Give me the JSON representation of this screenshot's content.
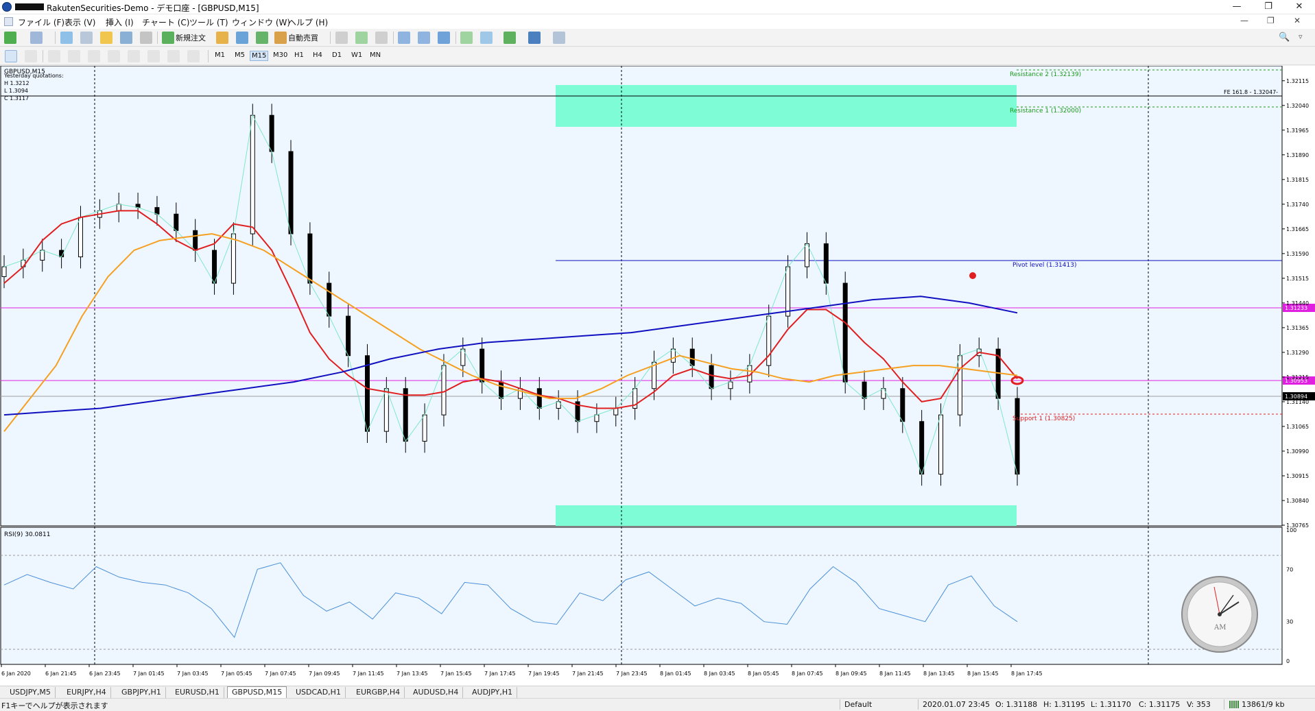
{
  "window": {
    "title": "RakutenSecurities-Demo - デモ口座 - [GBPUSD,M15]"
  },
  "menu": [
    "ファイル (F)",
    "表示 (V)",
    "挿入 (I)",
    "チャート (C)",
    "ツール (T)",
    "ウィンドウ (W)",
    "ヘルプ (H)"
  ],
  "toolbar": {
    "new_order": "新規注文",
    "auto_trading": "自動売買"
  },
  "timeframes": [
    "M1",
    "M5",
    "M15",
    "M30",
    "H1",
    "H4",
    "D1",
    "W1",
    "MN"
  ],
  "timeframe_selected": "M15",
  "chart": {
    "symbol_label": "GBPUSD,M15",
    "quote_title": "Yesterday quotations:",
    "quote_h": "H 1.3212",
    "quote_l": "L 1.3094",
    "quote_c": "C 1.3117",
    "price_ticks": [
      "1.32115",
      "1.32040",
      "1.31965",
      "1.31890",
      "1.31815",
      "1.31740",
      "1.31665",
      "1.31590",
      "1.31515",
      "1.31440",
      "1.31365",
      "1.31290",
      "1.31215",
      "1.31140",
      "1.31065",
      "1.30990",
      "1.30915",
      "1.30840",
      "1.30765"
    ],
    "resistance2_label": "Resistance 2 (1.32139)",
    "resistance1_label": "Resistance 1 (1.32000)",
    "fe_label": "FE 161.8 - 1.32047-",
    "pivot_label": "Pivot level (1.31413)",
    "support1_label": "Support 1 (1.30825)",
    "magenta_upper_price": "1.31233",
    "magenta_lower_price": "1.30953",
    "current_price": "1.30894",
    "rsi_label": "RSI(9) 30.0811",
    "rsi_ticks": [
      "100",
      "70",
      "30",
      "0"
    ],
    "time_labels": [
      "6 Jan 2020",
      "6 Jan 21:45",
      "6 Jan 23:45",
      "7 Jan 01:45",
      "7 Jan 03:45",
      "7 Jan 05:45",
      "7 Jan 07:45",
      "7 Jan 09:45",
      "7 Jan 11:45",
      "7 Jan 13:45",
      "7 Jan 15:45",
      "7 Jan 17:45",
      "7 Jan 19:45",
      "7 Jan 21:45",
      "7 Jan 23:45",
      "8 Jan 01:45",
      "8 Jan 03:45",
      "8 Jan 05:45",
      "8 Jan 07:45",
      "8 Jan 09:45",
      "8 Jan 11:45",
      "8 Jan 13:45",
      "8 Jan 15:45",
      "8 Jan 17:45"
    ],
    "clock_text": "AM",
    "colors": {
      "candle": "#000000",
      "ma_fast": "#7fe8c8",
      "ma_mid": "#e02020",
      "ma_slow": "#f5a020",
      "ma_long": "#1010c0",
      "zone": "#7dfcd6",
      "magenta": "#e020e0",
      "rsi": "#4a90d9",
      "background": "#eef6ff"
    }
  },
  "chart_data": {
    "type": "line",
    "title": "GBPUSD,M15",
    "ylim": [
      1.30765,
      1.32152
    ],
    "levels": {
      "resistance2": 1.32139,
      "resistance1": 1.32,
      "fe_161_8": 1.32047,
      "pivot": 1.31413,
      "support1": 1.30825,
      "magenta_upper": 1.31233,
      "magenta_lower": 1.30953,
      "current": 1.30894
    },
    "series": [
      {
        "values": [
          1.3155,
          1.3157,
          1.316,
          1.3158,
          1.317,
          1.3172,
          1.3174,
          1.3173,
          1.3171,
          1.3166,
          1.316,
          1.315,
          1.3165,
          1.3201,
          1.319,
          1.3165,
          1.315,
          1.314,
          1.3128,
          1.3105,
          1.3118,
          1.3102,
          1.311,
          1.3125,
          1.313,
          1.312,
          1.3115,
          1.3118,
          1.3112,
          1.3114,
          1.3108,
          1.311,
          1.3112,
          1.3118,
          1.3126,
          1.313,
          1.3125,
          1.3118,
          1.312,
          1.3125,
          1.314,
          1.3155,
          1.3162,
          1.315,
          1.312,
          1.3115,
          1.3118,
          1.3108,
          1.3092,
          1.311,
          1.3128,
          1.313,
          1.3115,
          1.3092
        ]
      },
      {
        "values": [
          1.315,
          1.3155,
          1.3163,
          1.3168,
          1.317,
          1.3171,
          1.3172,
          1.3172,
          1.3168,
          1.3163,
          1.316,
          1.3162,
          1.3168,
          1.3167,
          1.316,
          1.3148,
          1.3135,
          1.3127,
          1.3122,
          1.3118,
          1.3117,
          1.3116,
          1.3116,
          1.3117,
          1.312,
          1.3121,
          1.312,
          1.3118,
          1.3116,
          1.3115,
          1.3113,
          1.3112,
          1.3112,
          1.3113,
          1.3117,
          1.3122,
          1.3124,
          1.3122,
          1.3121,
          1.3122,
          1.3128,
          1.3136,
          1.3142,
          1.3142,
          1.3138,
          1.3132,
          1.3127,
          1.312,
          1.3114,
          1.3115,
          1.3124,
          1.3129,
          1.3128,
          1.3121
        ]
      },
      {
        "values": [
          1.3105,
          1.3115,
          1.3125,
          1.314,
          1.3152,
          1.316,
          1.3163,
          1.3164,
          1.3165,
          1.3163,
          1.316,
          1.3155,
          1.315,
          1.3145,
          1.314,
          1.3135,
          1.313,
          1.3126,
          1.3122,
          1.3119,
          1.3117,
          1.3115,
          1.3115,
          1.3118,
          1.3122,
          1.3125,
          1.3128,
          1.3126,
          1.3124,
          1.3123,
          1.3121,
          1.312,
          1.3122,
          1.3123,
          1.3124,
          1.3125,
          1.3125,
          1.3124,
          1.3123,
          1.3122
        ]
      },
      {
        "values": [
          1.311,
          1.3111,
          1.3112,
          1.3114,
          1.3116,
          1.3118,
          1.312,
          1.3123,
          1.3127,
          1.313,
          1.3132,
          1.3133,
          1.3134,
          1.3135,
          1.3137,
          1.3139,
          1.3141,
          1.3143,
          1.3145,
          1.3146,
          1.3144,
          1.3141
        ]
      },
      {
        "name": "RSI(9)",
        "values": [
          58,
          66,
          60,
          55,
          72,
          64,
          60,
          58,
          52,
          40,
          18,
          70,
          75,
          50,
          38,
          45,
          32,
          52,
          48,
          36,
          60,
          58,
          40,
          30,
          28,
          52,
          46,
          62,
          68,
          55,
          42,
          48,
          44,
          30,
          28,
          55,
          72,
          60,
          40,
          35,
          30,
          58,
          65,
          42,
          30
        ]
      }
    ]
  },
  "tabs": [
    "USDJPY,M5",
    "EURJPY,H4",
    "GBPJPY,H1",
    "EURUSD,H1",
    "GBPUSD,M15",
    "USDCAD,H1",
    "EURGBP,H4",
    "AUDUSD,H4",
    "AUDJPY,H1"
  ],
  "active_tab": "GBPUSD,M15",
  "status": {
    "help": "F1キーでヘルプが表示されます",
    "profile": "Default",
    "time": "2020.01.07 23:45",
    "open": "O: 1.31188",
    "high": "H: 1.31195",
    "low": "L: 1.31170",
    "close": "C: 1.31175",
    "volume": "V: 353",
    "traffic": "13861/9 kb"
  }
}
